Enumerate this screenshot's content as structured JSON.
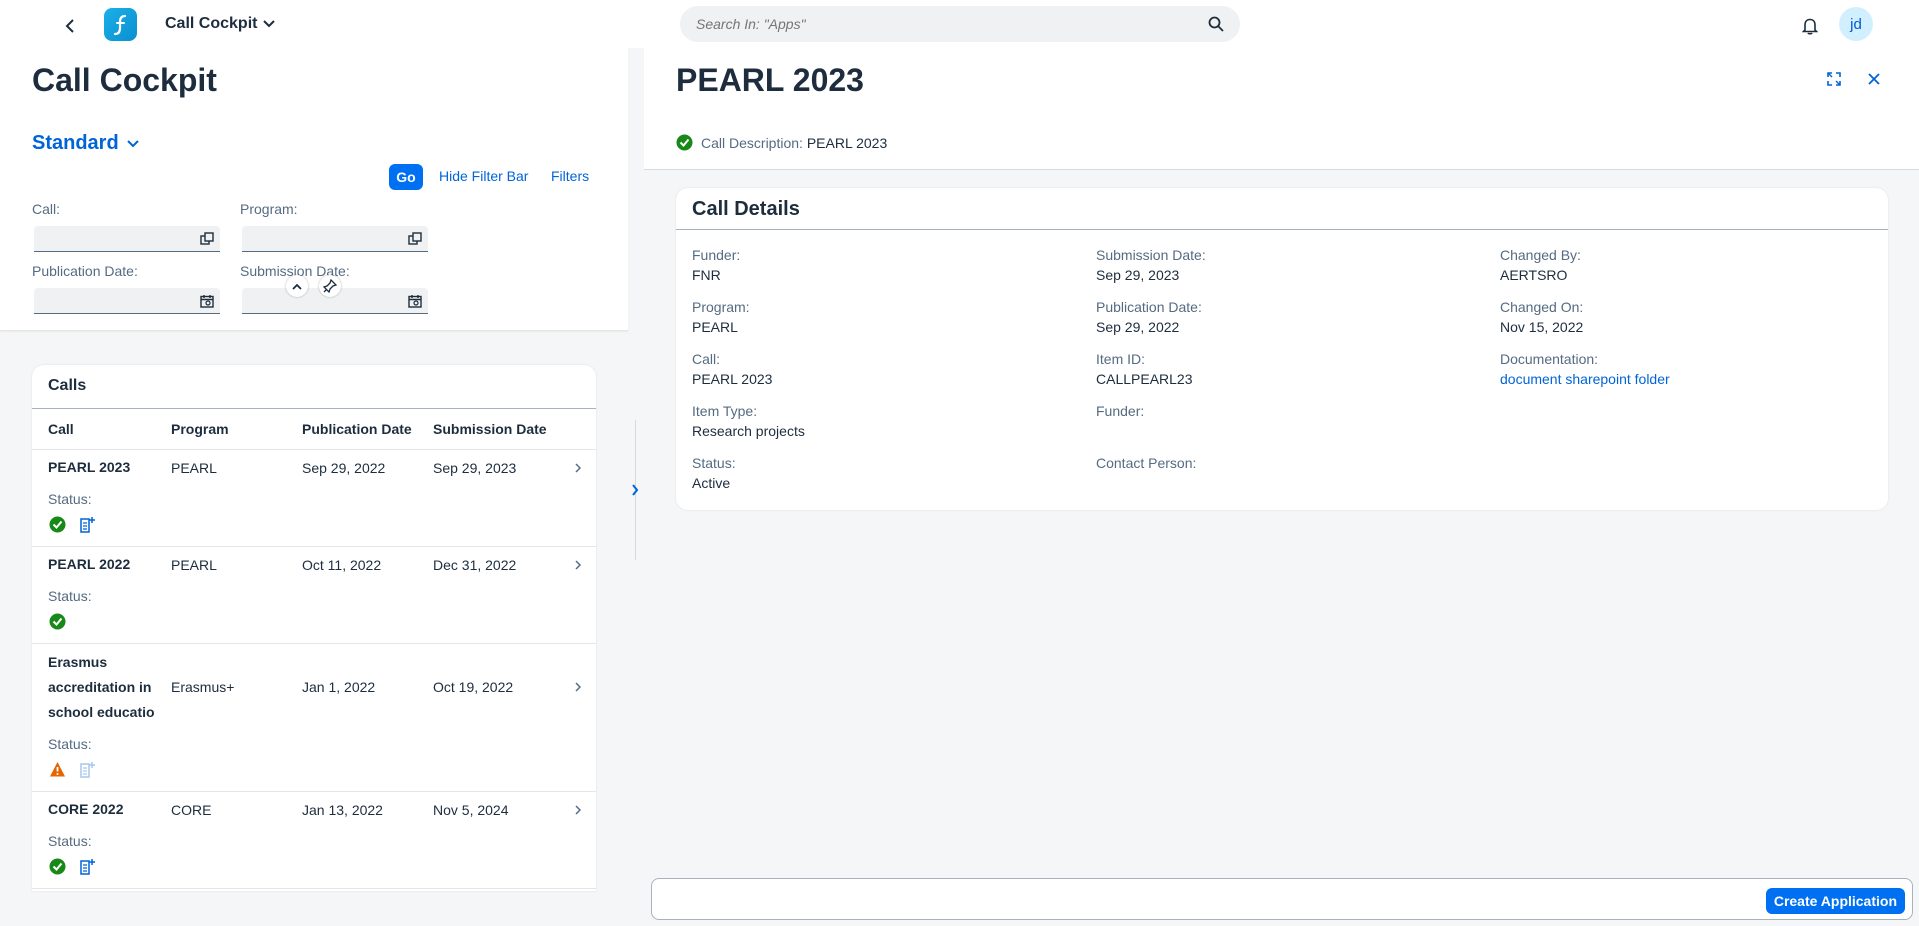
{
  "shell": {
    "app_title": "Call Cockpit",
    "search_placeholder": "Search In: \"Apps\"",
    "avatar_initials": "jd"
  },
  "left": {
    "page_title": "Call Cockpit",
    "variant": "Standard",
    "go_label": "Go",
    "hide_filter_label": "Hide Filter Bar",
    "filters_label": "Filters",
    "filters": {
      "call_label": "Call:",
      "program_label": "Program:",
      "publication_label": "Publication Date:",
      "submission_label": "Submission Date:"
    }
  },
  "calls": {
    "title": "Calls",
    "columns": [
      "Call",
      "Program",
      "Publication Date",
      "Submission Date"
    ],
    "status_label": "Status:",
    "rows": [
      {
        "call": "PEARL 2023",
        "program": "PEARL",
        "publication": "Sep 29, 2022",
        "submission": "Sep 29, 2023",
        "status": "success",
        "doc": "active"
      },
      {
        "call": "PEARL 2022",
        "program": "PEARL",
        "publication": "Oct 11, 2022",
        "submission": "Dec 31, 2022",
        "status": "success",
        "doc": "none"
      },
      {
        "call": "Erasmus accreditation in school educatio",
        "program": "Erasmus+",
        "publication": "Jan 1, 2022",
        "submission": "Oct 19, 2022",
        "status": "warning",
        "doc": "disabled"
      },
      {
        "call": "CORE 2022",
        "program": "CORE",
        "publication": "Jan 13, 2022",
        "submission": "Nov 5, 2024",
        "status": "success",
        "doc": "active"
      }
    ]
  },
  "detail": {
    "title": "PEARL 2023",
    "desc_label": "Call Description:",
    "desc_value": "PEARL 2023",
    "section_title": "Call Details",
    "col1": [
      {
        "label": "Funder:",
        "value": "FNR"
      },
      {
        "label": "Program:",
        "value": "PEARL"
      },
      {
        "label": "Call:",
        "value": "PEARL 2023"
      },
      {
        "label": "Item Type:",
        "value": "Research projects"
      },
      {
        "label": "Status:",
        "value": "Active"
      }
    ],
    "col2": [
      {
        "label": "Submission Date:",
        "value": "Sep 29, 2023"
      },
      {
        "label": "Publication Date:",
        "value": "Sep 29, 2022"
      },
      {
        "label": "Item ID:",
        "value": "CALLPEARL23"
      },
      {
        "label": "Funder:",
        "value": ""
      },
      {
        "label": "Contact Person:",
        "value": ""
      }
    ],
    "col3": [
      {
        "label": "Changed By:",
        "value": "AERTSRO"
      },
      {
        "label": "Changed On:",
        "value": "Nov 15, 2022"
      },
      {
        "label": "Documentation:",
        "value": "document sharepoint folder"
      }
    ]
  },
  "footer": {
    "create_label": "Create Application"
  },
  "colors": {
    "accent": "#0070f2",
    "success": "#188918",
    "warning": "#e76500",
    "link": "#0064d9"
  }
}
